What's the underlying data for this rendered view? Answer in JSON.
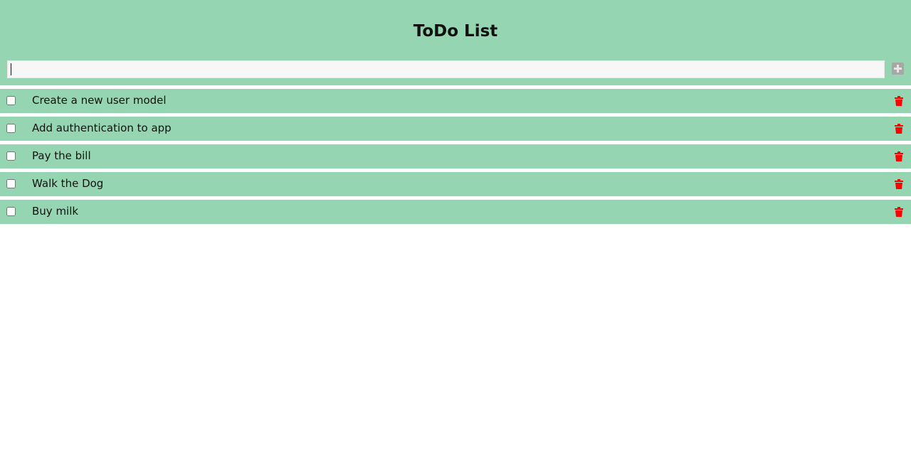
{
  "app": {
    "title": "ToDo List"
  },
  "new_task": {
    "value": "",
    "placeholder": "",
    "add_icon": "plus-icon"
  },
  "todos": [
    {
      "text": "Create a new user model",
      "done": false
    },
    {
      "text": "Add authentication to app",
      "done": false
    },
    {
      "text": "Pay the bill",
      "done": false
    },
    {
      "text": "Walk the Dog",
      "done": false
    },
    {
      "text": "Buy milk",
      "done": false
    }
  ],
  "colors": {
    "accent": "#96d5b2",
    "delete": "#ff0000",
    "add_button": "#a7a7a7"
  },
  "icons": {
    "delete": "trash-icon"
  }
}
